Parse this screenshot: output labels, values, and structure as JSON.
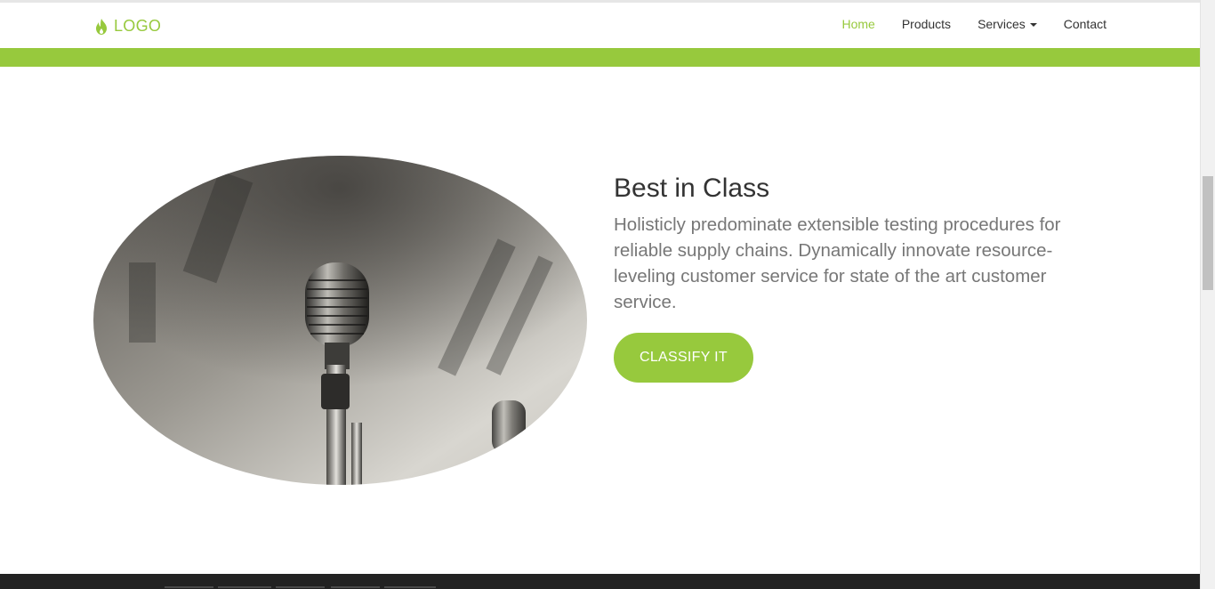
{
  "brand": {
    "text": "LOGO",
    "icon": "flame-icon",
    "color": "#97c93d"
  },
  "nav": {
    "items": [
      {
        "label": "Home",
        "active": true
      },
      {
        "label": "Products",
        "active": false
      },
      {
        "label": "Services",
        "active": false,
        "dropdown": true
      },
      {
        "label": "Contact",
        "active": false
      }
    ]
  },
  "feature": {
    "image": "microphone-photo",
    "title": "Best in Class",
    "description": "Holisticly predominate extensible testing procedures for reliable supply chains. Dynamically innovate resource-leveling customer service for state of the art customer service.",
    "button_label": "CLASSIFY IT"
  },
  "colors": {
    "accent": "#97c93d",
    "footer": "#222222",
    "heading": "#333333",
    "body_text": "#777777"
  }
}
